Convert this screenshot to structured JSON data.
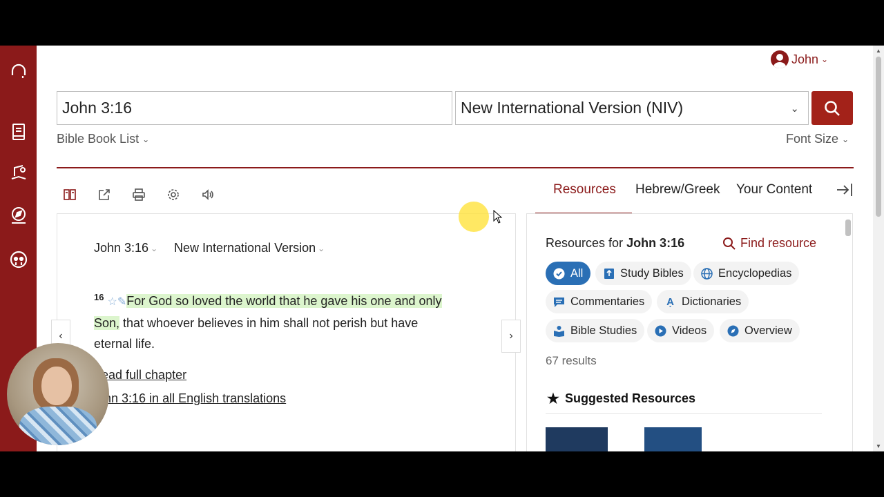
{
  "app": {
    "user_name": "John",
    "colors": {
      "brand": "#8b1a1a",
      "search_button": "#a32219",
      "chip_active": "#2a6fb5",
      "highlight": "#dcf5cd"
    }
  },
  "rail": {
    "icons": [
      "headphones-icon",
      "book-icon",
      "reading-plan-icon",
      "compass-icon",
      "community-icon"
    ]
  },
  "search": {
    "query": "John 3:16",
    "version": "New International Version (NIV)",
    "bible_book_list": "Bible Book List",
    "font_size": "Font Size"
  },
  "toolbar": {
    "icons": [
      "parallel-icon",
      "share-icon",
      "print-icon",
      "settings-icon",
      "audio-icon"
    ]
  },
  "tabs": [
    {
      "label": "Resources",
      "active": true
    },
    {
      "label": "Hebrew/Greek",
      "active": false
    },
    {
      "label": "Your Content",
      "active": false
    }
  ],
  "passage": {
    "reference": "John 3:16",
    "version": "New International Version",
    "verse_number": "16",
    "text_highlighted": "For God so loved the world that he gave his one and only Son,",
    "text_rest": " that whoever believes in him shall not perish but have eternal life.",
    "read_full_chapter": "ead full chapter",
    "all_translations": "hn 3:16 in all English translations"
  },
  "resources": {
    "title_prefix": "Resources for",
    "title_ref": "John 3:16",
    "find_resource": "Find resource",
    "filters": [
      {
        "label": "All",
        "icon": "check-icon",
        "active": true
      },
      {
        "label": "Study Bibles",
        "icon": "study-bible-icon",
        "active": false
      },
      {
        "label": "Encyclopedias",
        "icon": "globe-icon",
        "active": false
      },
      {
        "label": "Commentaries",
        "icon": "comment-icon",
        "active": false
      },
      {
        "label": "Dictionaries",
        "icon": "dictionary-icon",
        "active": false
      },
      {
        "label": "Bible Studies",
        "icon": "bible-study-icon",
        "active": false
      },
      {
        "label": "Videos",
        "icon": "play-icon",
        "active": false
      },
      {
        "label": "Overview",
        "icon": "compass-icon",
        "active": false
      }
    ],
    "results_count": "67 results",
    "suggested_title": "Suggested Resources"
  }
}
